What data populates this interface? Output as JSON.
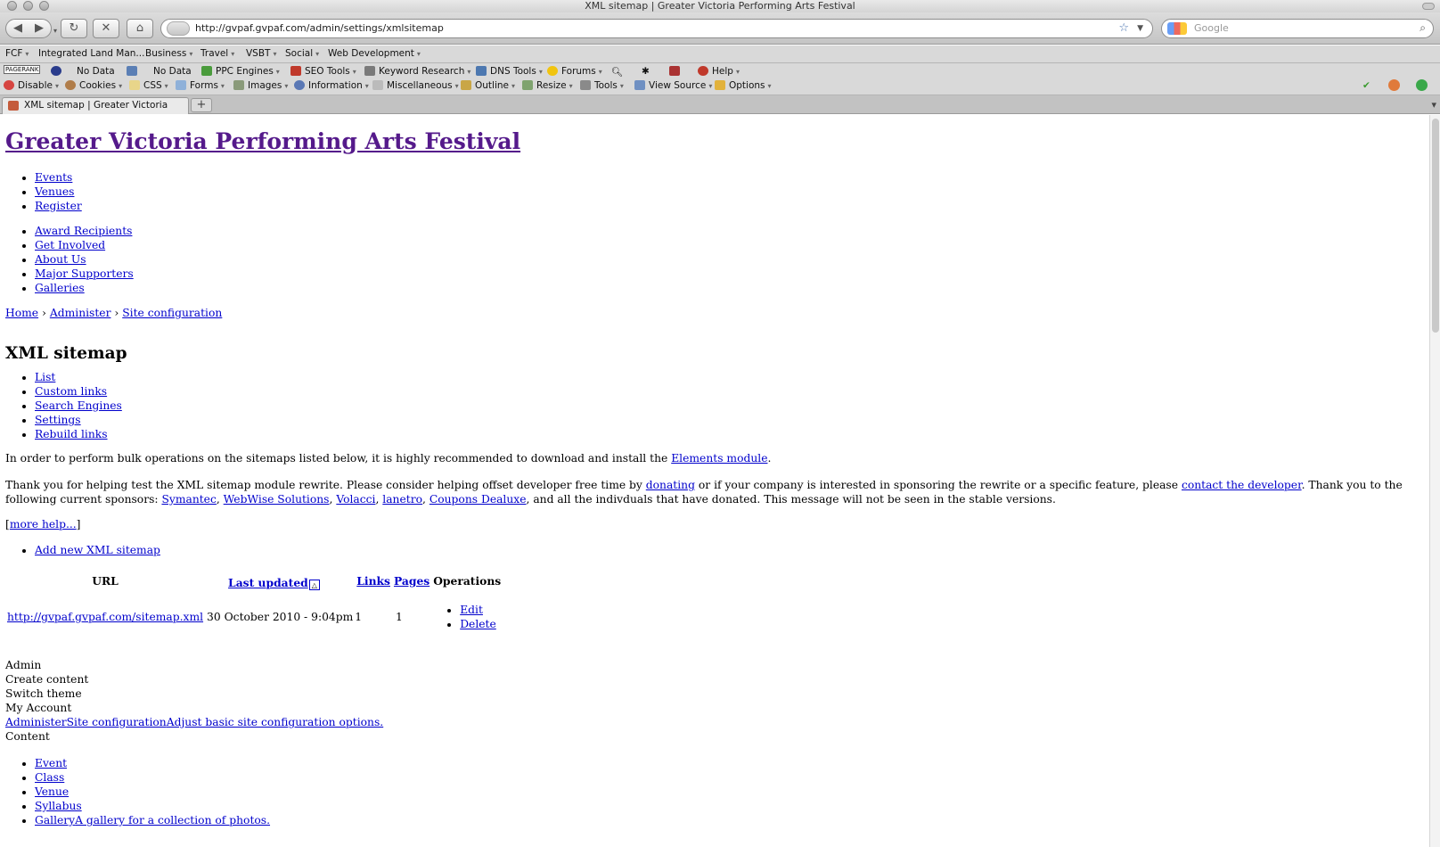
{
  "window": {
    "title": "XML sitemap | Greater Victoria Performing Arts Festival"
  },
  "nav": {
    "back_icon": "back-arrow-icon",
    "forward_icon": "forward-arrow-icon",
    "url": "http://gvpaf.gvpaf.com/admin/settings/xmlsitemap",
    "search_placeholder": "Google"
  },
  "bookmarks": [
    {
      "label": "FCF"
    },
    {
      "label": "Integrated Land Man..."
    },
    {
      "label": "Business"
    },
    {
      "label": "Travel"
    },
    {
      "label": "VSBT"
    },
    {
      "label": "Social"
    },
    {
      "label": "Web Development"
    }
  ],
  "seo_toolbar": {
    "pagerank": "PAGERANK",
    "nodata1": "No Data",
    "nodata2": "No Data",
    "items": [
      "PPC Engines",
      "SEO Tools",
      "Keyword Research",
      "DNS Tools",
      "Forums",
      "Help"
    ]
  },
  "dev_toolbar": {
    "items": [
      "Disable",
      "Cookies",
      "CSS",
      "Forms",
      "Images",
      "Information",
      "Miscellaneous",
      "Outline",
      "Resize",
      "Tools",
      "View Source",
      "Options"
    ]
  },
  "tabs": [
    {
      "label": "XML sitemap | Greater Victoria Per..."
    }
  ],
  "new_tab": "+",
  "site": {
    "title": "Greater Victoria Performing Arts Festival",
    "primary_links": [
      "Events",
      "Venues",
      "Register"
    ],
    "secondary_links": [
      "Award Recipients",
      "Get Involved",
      "About Us",
      "Major Supporters",
      "Galleries"
    ]
  },
  "breadcrumb": {
    "items": [
      "Home",
      "Administer",
      "Site configuration"
    ],
    "sep": "›"
  },
  "page_title": "XML sitemap",
  "local_tasks": [
    "List",
    "Custom links",
    "Search Engines",
    "Settings",
    "Rebuild links"
  ],
  "messages": {
    "elements_pre": "In order to perform bulk operations on the sitemaps listed below, it is highly recommended to download and install the ",
    "elements_link": "Elements module",
    "elements_post": ".",
    "thanks_1": "Thank you for helping test the XML sitemap module rewrite. Please consider helping offset developer free time by ",
    "donating": "donating",
    "thanks_2": " or if your company is interested in sponsoring the rewrite or a specific feature, please ",
    "contact": "contact the developer",
    "thanks_3": ". Thank you to the following current sponsors: ",
    "sponsors": [
      "Symantec",
      "WebWise Solutions",
      "Volacci",
      "lanetro",
      "Coupons Dealuxe"
    ],
    "thanks_4": ", and all the indivduals that have donated. This message will not be seen in the stable versions.",
    "more_help_open": "[",
    "more_help": "more help...",
    "more_help_close": "]"
  },
  "add_link": "Add new XML sitemap",
  "table": {
    "headers": {
      "url": "URL",
      "last_updated": "Last updated",
      "links": "Links",
      "pages": "Pages",
      "operations": "Operations"
    },
    "rows": [
      {
        "url": "http://gvpaf.gvpaf.com/sitemap.xml",
        "updated": "30 October 2010 - 9:04pm",
        "links": "1",
        "pages": "1",
        "ops": [
          "Edit",
          "Delete"
        ]
      }
    ]
  },
  "admin_menu": {
    "lines": [
      "Admin",
      "Create content",
      "Switch theme",
      "My Account"
    ],
    "link_line": [
      "Administer",
      "Site configuration",
      "Adjust basic site configuration options."
    ],
    "content_label": "Content",
    "content_items": [
      "Event",
      "Class",
      "Venue",
      "Syllabus",
      "Gallery",
      "A gallery for a collection of photos."
    ]
  }
}
